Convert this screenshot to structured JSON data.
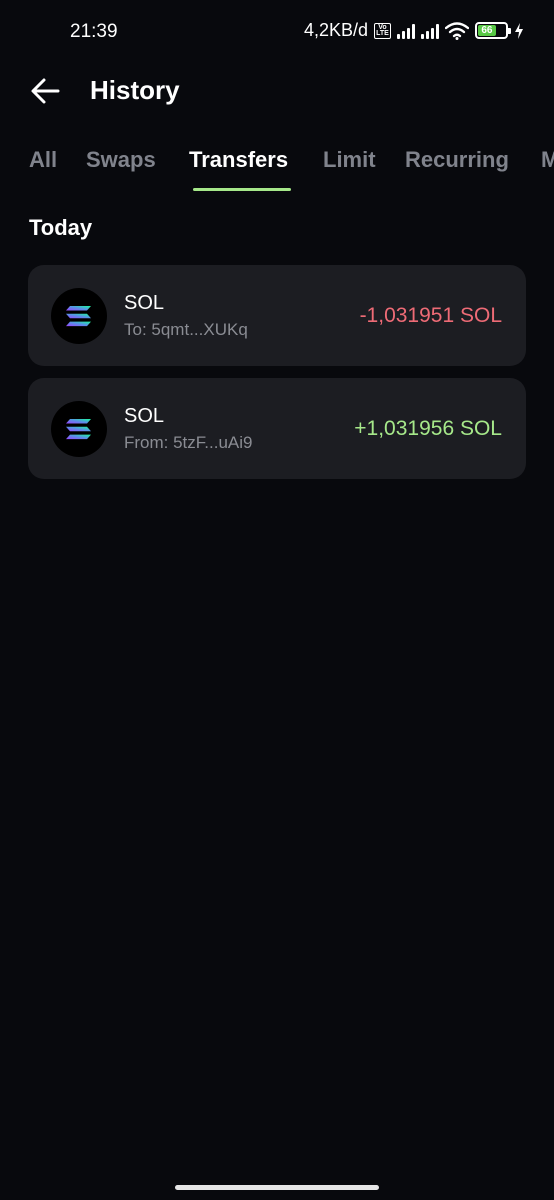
{
  "status_bar": {
    "time": "21:39",
    "net_speed": "4,2KB/d",
    "volte_label": "Vo LTE",
    "battery_level": "66",
    "icons": [
      "volte-icon",
      "signal-icon",
      "signal-icon",
      "wifi-icon",
      "battery-icon",
      "charging-icon"
    ]
  },
  "header": {
    "back_icon": "arrow-left-icon",
    "title": "History"
  },
  "tabs": [
    {
      "label": "All",
      "active": false
    },
    {
      "label": "Swaps",
      "active": false
    },
    {
      "label": "Transfers",
      "active": true
    },
    {
      "label": "Limit",
      "active": false
    },
    {
      "label": "Recurring",
      "active": false
    },
    {
      "label": "M",
      "active": false
    }
  ],
  "section": {
    "title": "Today"
  },
  "transactions": [
    {
      "token": "SOL",
      "address": "To: 5qmt...XUKq",
      "amount": "-1,031951 SOL",
      "direction": "out",
      "icon": "solana-icon"
    },
    {
      "token": "SOL",
      "address": "From: 5tzF...uAi9",
      "amount": "+1,031956 SOL",
      "direction": "in",
      "icon": "solana-icon"
    }
  ],
  "colors": {
    "background": "#08090d",
    "card": "#1c1d22",
    "accent_green": "#a6e88a",
    "negative_red": "#ee6b76",
    "muted_text": "#80838c"
  }
}
